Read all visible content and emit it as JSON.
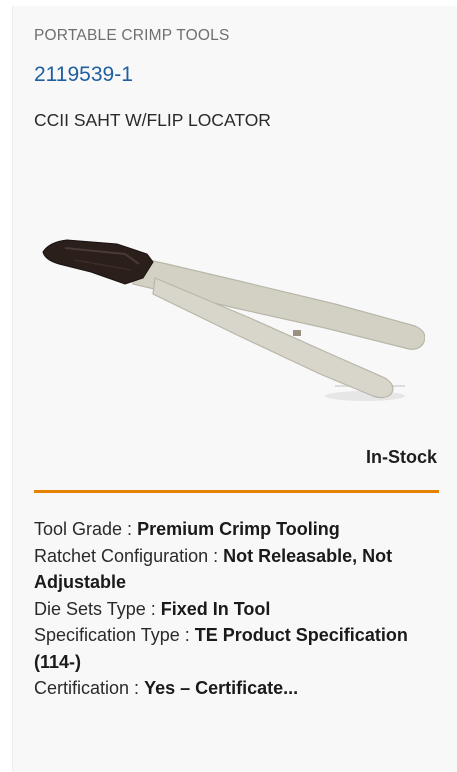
{
  "product": {
    "category": "PORTABLE CRIMP TOOLS",
    "part_number": "2119539-1",
    "description": "CCII SAHT W/FLIP LOCATOR",
    "image_icon": "crimp-tool-image",
    "stock_status": "In-Stock",
    "divider_color": "#e58300",
    "attributes": [
      {
        "label": "Tool Grade :",
        "value": "Premium Crimp Tooling"
      },
      {
        "label": "Ratchet Configuration :",
        "value": "Not Releasable, Not Adjustable"
      },
      {
        "label": "Die Sets Type :",
        "value": "Fixed In Tool"
      },
      {
        "label": "Specification Type :",
        "value": "TE Product Specification (114-)"
      },
      {
        "label": "Certification :",
        "value": "Yes – Certificate..."
      }
    ]
  }
}
